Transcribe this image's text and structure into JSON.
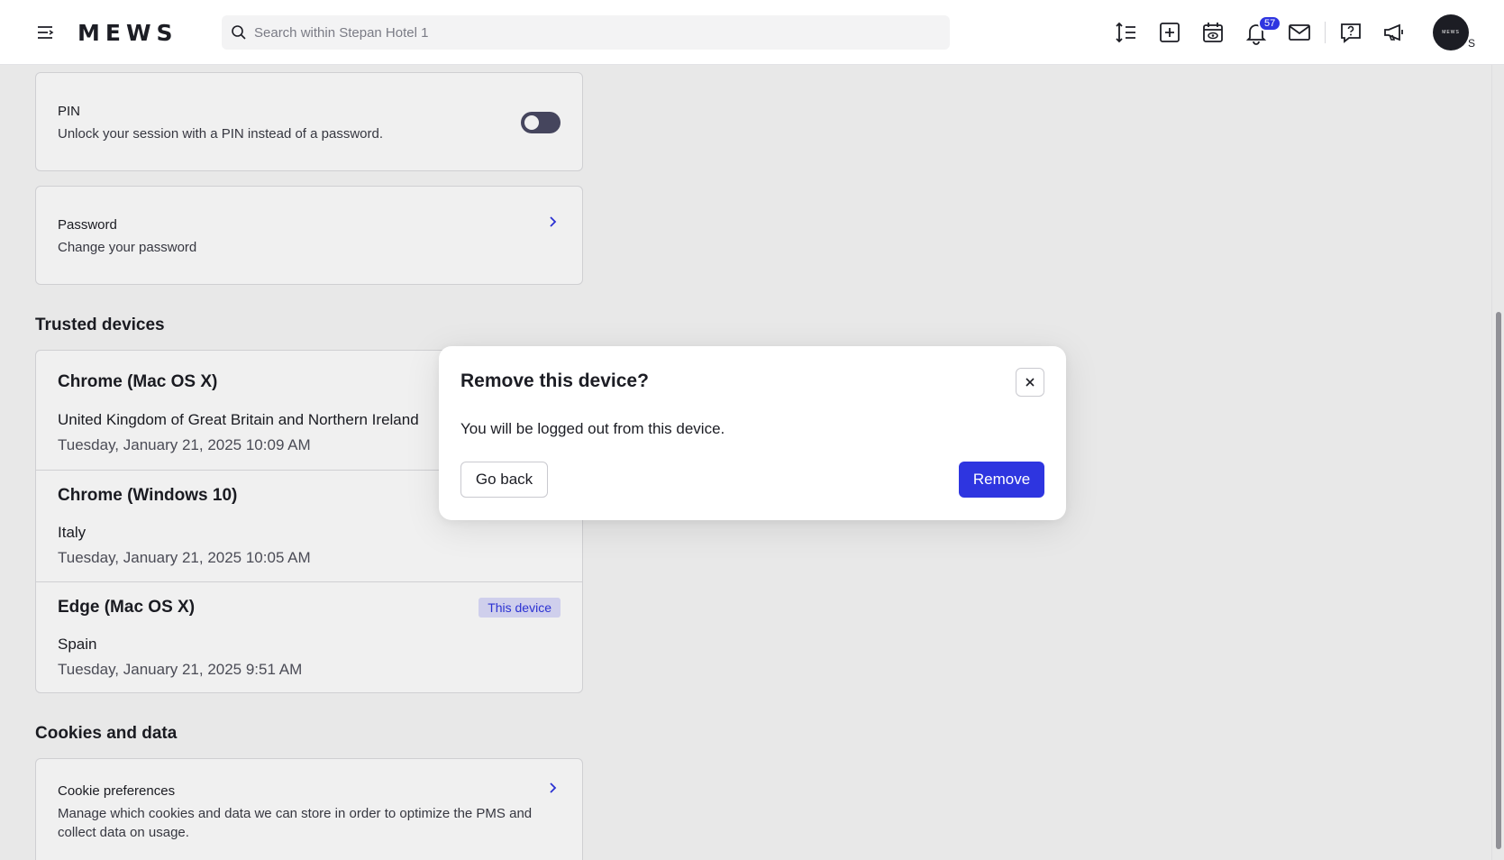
{
  "app": {
    "logo": "MEWS"
  },
  "header": {
    "search_placeholder": "Search within Stepan Hotel 1",
    "notifications_count": "57",
    "avatar_text": "MEWS",
    "avatar_letter": "S",
    "icons": [
      "menu-icon",
      "timeline-icon",
      "add-icon",
      "calendar-view-icon",
      "bell-icon",
      "mail-icon",
      "help-icon",
      "announcements-icon"
    ]
  },
  "security": {
    "pin": {
      "title": "PIN",
      "description": "Unlock your session with a PIN instead of a password.",
      "enabled": false
    },
    "password": {
      "title": "Password",
      "description": "Change your password"
    }
  },
  "trusted_devices": {
    "heading": "Trusted devices",
    "devices": [
      {
        "name": "Chrome (Mac OS X)",
        "country": "United Kingdom of Great Britain and Northern Ireland",
        "date": "Tuesday, January 21, 2025 10:09 AM"
      },
      {
        "name": "Chrome (Windows 10)",
        "country": "Italy",
        "date": "Tuesday, January 21, 2025 10:05 AM"
      },
      {
        "name": "Edge (Mac OS X)",
        "country": "Spain",
        "date": "Tuesday, January 21, 2025 9:51 AM",
        "badge": "This device"
      }
    ]
  },
  "cookies": {
    "heading": "Cookies and data",
    "title": "Cookie preferences",
    "description_line1": "Manage which cookies and data we can store in order to optimize the PMS and",
    "description_line2": "collect data on usage."
  },
  "modal": {
    "title": "Remove this device?",
    "body": "You will be logged out from this device.",
    "back_label": "Go back",
    "remove_label": "Remove"
  },
  "colors": {
    "primary": "#2e35e0",
    "toggle_off": "#4a4a63",
    "badge_bg": "#dcdcfb"
  }
}
